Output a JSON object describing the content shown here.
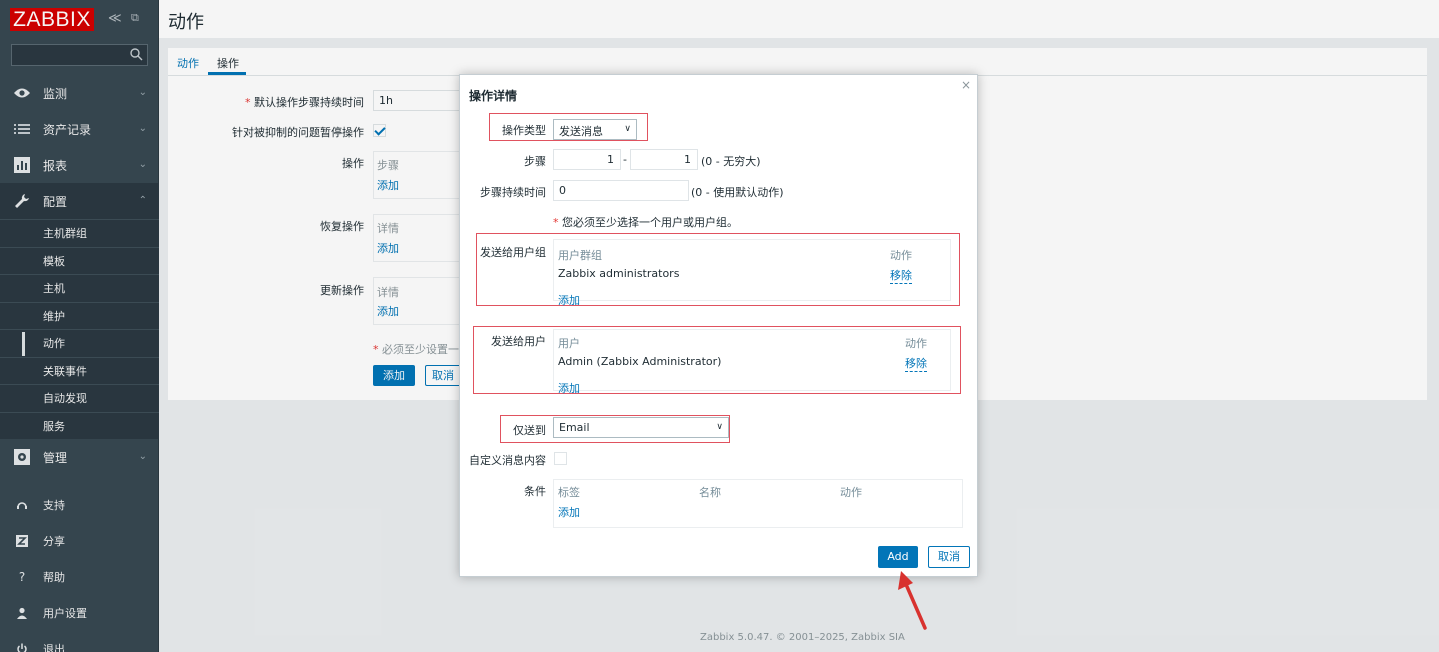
{
  "app": {
    "logo": "ZABBIX",
    "collapse_glyph": "≪",
    "kiosk_glyph": "⧉"
  },
  "sidebar": {
    "search_placeholder": "",
    "items": [
      {
        "label": "监测",
        "icon": "eye-icon"
      },
      {
        "label": "资产记录",
        "icon": "list-icon"
      },
      {
        "label": "报表",
        "icon": "bar-chart-icon"
      },
      {
        "label": "配置",
        "icon": "wrench-icon"
      }
    ],
    "config_subitems": [
      "主机群组",
      "模板",
      "主机",
      "维护",
      "动作",
      "关联事件",
      "自动发现",
      "服务"
    ],
    "admin_label": "管理",
    "bottom_items": [
      {
        "label": "支持",
        "icon": "headset-icon"
      },
      {
        "label": "分享",
        "icon": "share-icon"
      },
      {
        "label": "帮助",
        "icon": "help-icon"
      },
      {
        "label": "用户设置",
        "icon": "user-icon"
      },
      {
        "label": "退出",
        "icon": "power-icon"
      }
    ]
  },
  "header": {
    "title": "动作"
  },
  "tabs": {
    "action": "动作",
    "operations": "操作"
  },
  "form": {
    "default_duration_label": "默认操作步骤持续时间",
    "default_duration_value": "1h",
    "pause_suppressed_label": "针对被抑制的问题暂停操作",
    "operations_label": "操作",
    "operations_col": "步骤",
    "recovery_label": "恢复操作",
    "recovery_col": "详情",
    "update_label": "更新操作",
    "update_col": "详情",
    "add_link": "添加",
    "required_note": "必须至少设置一",
    "add_button": "添加",
    "cancel_button": "取消"
  },
  "footer": {
    "text": "Zabbix 5.0.47. © 2001–2025, Zabbix SIA"
  },
  "dialog": {
    "title": "操作详情",
    "close": "×",
    "operation_type_label": "操作类型",
    "operation_type_value": "发送消息",
    "steps_label": "步骤",
    "step_from": "1",
    "step_to": "1",
    "step_dash": "-",
    "steps_hint": "(0 - 无穷大)",
    "step_duration_label": "步骤持续时间",
    "step_duration_value": "0",
    "step_duration_hint": "(0 - 使用默认动作)",
    "must_select_note": "您必须至少选择一个用户或用户组。",
    "send_groups_label": "发送给用户组",
    "groups_col_name": "用户群组",
    "groups_col_action": "动作",
    "group_row_name": "Zabbix administrators",
    "group_row_remove": "移除",
    "groups_add": "添加",
    "send_users_label": "发送给用户",
    "users_col_name": "用户",
    "users_col_action": "动作",
    "user_row_name": "Admin (Zabbix Administrator)",
    "user_row_remove": "移除",
    "users_add": "添加",
    "send_only_label": "仅送到",
    "send_only_value": "Email",
    "custom_message_label": "自定义消息内容",
    "conditions_label": "条件",
    "cond_col_label": "标签",
    "cond_col_name": "名称",
    "cond_col_action": "动作",
    "cond_add": "添加",
    "add_button": "Add",
    "cancel_button": "取消"
  },
  "colors": {
    "accent": "#0275b8",
    "logo_red": "#d40000",
    "sidebar": "#384852",
    "highlight_frame": "#e0525f"
  }
}
